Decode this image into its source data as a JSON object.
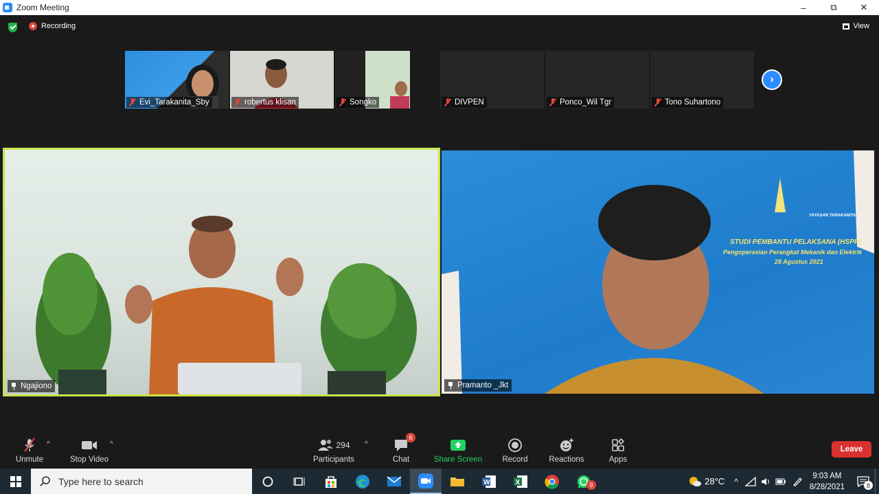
{
  "window": {
    "title": "Zoom Meeting",
    "minimize": "–",
    "restore": "⧉",
    "close": "✕"
  },
  "topbar": {
    "recording_label": "Recording",
    "view_label": "View"
  },
  "participants_strip": [
    {
      "name": "Evi_Tarakanita_Sby",
      "muted": true
    },
    {
      "name": "robertus klisan",
      "muted": true
    },
    {
      "name": "Songko",
      "muted": true
    },
    {
      "name": "DIVPEN",
      "muted": true
    },
    {
      "name": "Ponco_Wil Tgr",
      "muted": true
    },
    {
      "name": "Tono Suhartono",
      "muted": true
    }
  ],
  "main_videos": [
    {
      "name": "Ngajiono",
      "active_speaker": true,
      "accent": "#c8e44a"
    },
    {
      "name": "Pramanto _Jkt",
      "active_speaker": false,
      "slide_text": [
        "YAYASAN TARAKANITA",
        "STUDI PEMBANTU PELAKSANA (HSPP)",
        "Pengoperasian Perangkat Mekanik dan Elektrik",
        "28 Agustus 2021"
      ]
    }
  ],
  "toolbar": {
    "unmute": "Unmute",
    "stop_video": "Stop Video",
    "participants": "Participants",
    "participants_count": "294",
    "chat": "Chat",
    "chat_badge": "6",
    "share_screen": "Share Screen",
    "record": "Record",
    "reactions": "Reactions",
    "apps": "Apps",
    "leave": "Leave"
  },
  "taskbar": {
    "search_placeholder": "Type here to search",
    "whatsapp_badge": "9",
    "weather": "28°C",
    "time": "9:03 AM",
    "date": "8/28/2021",
    "notification_count": "8"
  },
  "colors": {
    "zoom_blue": "#2d8cff",
    "leave_red": "#d9312e",
    "share_green": "#23d160",
    "speaker_border": "#c8e44a"
  }
}
